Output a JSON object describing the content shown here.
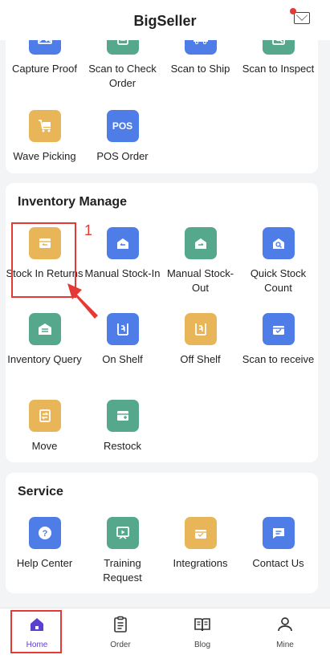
{
  "header": {
    "title": "BigSeller"
  },
  "order_section": {
    "items": [
      {
        "label": "Capture Proof",
        "icon": "image-icon",
        "color": "blue"
      },
      {
        "label": "Scan to Check Order",
        "icon": "checklist-icon",
        "color": "green"
      },
      {
        "label": "Scan to Ship",
        "icon": "truck-icon",
        "color": "blue"
      },
      {
        "label": "Scan to Inspect",
        "icon": "inspect-icon",
        "color": "green"
      },
      {
        "label": "Wave Picking",
        "icon": "cart-icon",
        "color": "yellow"
      },
      {
        "label": "POS Order",
        "icon": "pos-icon",
        "color": "blue",
        "badge": "POS"
      }
    ]
  },
  "inventory_section": {
    "title": "Inventory Manage",
    "items": [
      {
        "label": "Stock In Returns",
        "icon": "box-return-icon",
        "color": "yellow"
      },
      {
        "label": "Manual Stock-In",
        "icon": "stock-in-icon",
        "color": "blue"
      },
      {
        "label": "Manual Stock-Out",
        "icon": "stock-out-icon",
        "color": "green"
      },
      {
        "label": "Quick Stock Count",
        "icon": "stock-count-icon",
        "color": "blue"
      },
      {
        "label": "Inventory Query",
        "icon": "warehouse-icon",
        "color": "green"
      },
      {
        "label": "On Shelf",
        "icon": "on-shelf-icon",
        "color": "blue"
      },
      {
        "label": "Off Shelf",
        "icon": "off-shelf-icon",
        "color": "yellow"
      },
      {
        "label": "Scan to receive",
        "icon": "receive-icon",
        "color": "blue"
      },
      {
        "label": "Move",
        "icon": "move-icon",
        "color": "yellow"
      },
      {
        "label": "Restock",
        "icon": "restock-icon",
        "color": "green"
      }
    ]
  },
  "service_section": {
    "title": "Service",
    "items": [
      {
        "label": "Help Center",
        "icon": "help-icon",
        "color": "blue"
      },
      {
        "label": "Training Request",
        "icon": "training-icon",
        "color": "green"
      },
      {
        "label": "Integrations",
        "icon": "integrations-icon",
        "color": "yellow"
      },
      {
        "label": "Contact Us",
        "icon": "chat-icon",
        "color": "blue"
      }
    ]
  },
  "annotation": {
    "step": "1"
  },
  "tabs": [
    {
      "label": "Home",
      "icon": "home-icon",
      "active": true
    },
    {
      "label": "Order",
      "icon": "clipboard-icon",
      "active": false
    },
    {
      "label": "Blog",
      "icon": "book-icon",
      "active": false
    },
    {
      "label": "Mine",
      "icon": "user-icon",
      "active": false
    }
  ],
  "colors": {
    "blue": "#4f7de8",
    "green": "#55a88c",
    "yellow": "#e8b558",
    "accent": "#5b3fd3",
    "highlight": "#e53935"
  }
}
